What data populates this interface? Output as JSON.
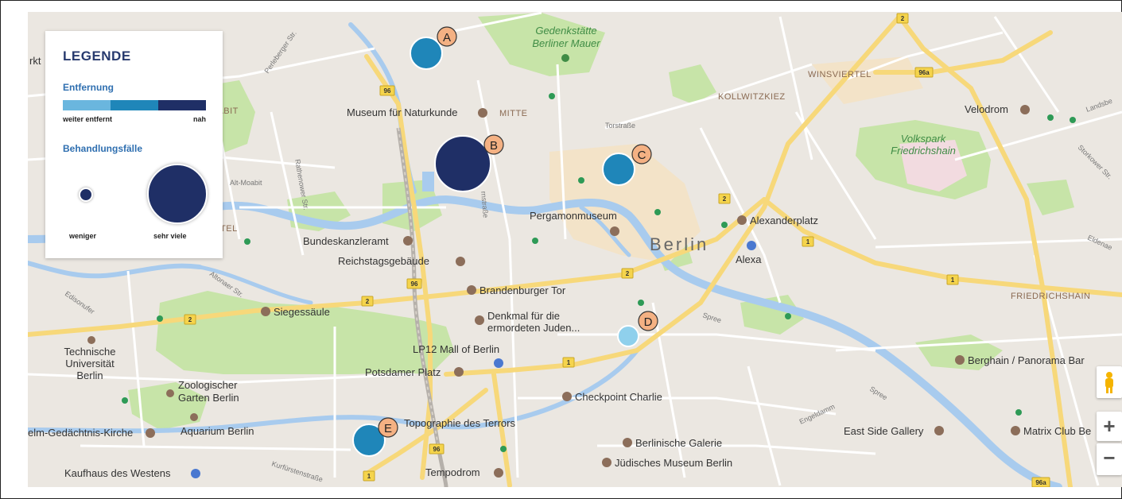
{
  "legend": {
    "title": "LEGENDE",
    "distance_heading": "Entfernung",
    "distance_far": "weiter entfernt",
    "distance_near": "nah",
    "distance_colors": [
      "#6ab6de",
      "#1f86b9",
      "#1f2f66"
    ],
    "cases_heading": "Behandlungsfälle",
    "cases_few": "weniger",
    "cases_many": "sehr viele"
  },
  "markers": [
    {
      "label": "A",
      "distance_class": "medium",
      "cases_level": "small"
    },
    {
      "label": "B",
      "distance_class": "near",
      "cases_level": "very large"
    },
    {
      "label": "C",
      "distance_class": "medium",
      "cases_level": "small"
    },
    {
      "label": "D",
      "distance_class": "far",
      "cases_level": "small"
    },
    {
      "label": "E",
      "distance_class": "medium",
      "cases_level": "small"
    }
  ],
  "places": {
    "gedenkstaette": "Gedenkstätte",
    "berliner_mauer": "Berliner Mauer",
    "winsviertel": "WINSVIERTEL",
    "kollwitzkiez": "KOLLWITZKIEZ",
    "museum_naturkunde": "Museum für Naturkunde",
    "mitte": "MITTE",
    "velodrom": "Velodrom",
    "volkspark": "Volkspark",
    "friedrichshain_park": "Friedrichshain",
    "torstrasse": "Torstraße",
    "alt_moabit": "Alt-Moabit",
    "moabit": "DABIT",
    "pergamonmuseum": "Pergamonmuseum",
    "berlin": "Berlin",
    "alexanderplatz": "Alexanderplatz",
    "alexa": "Alexa",
    "bundeskanzleramt": "Bundeskanzleramt",
    "reichstagsgebaeude": "Reichstagsgebäude",
    "brandenburger_tor": "Brandenburger Tor",
    "siegessaeule": "Siegessäule",
    "denkmal_1": "Denkmal für die",
    "denkmal_2": "ermordeten Juden...",
    "friedrichshain_district": "FRIEDRICHSHAIN",
    "technische_1": "Technische",
    "technische_2": "Universität",
    "technische_3": "Berlin",
    "lp12": "LP12 Mall of Berlin",
    "potsdamer_platz": "Potsdamer Platz",
    "berghain": "Berghain / Panorama Bar",
    "zoologischer_1": "Zoologischer",
    "zoologischer_2": "Garten Berlin",
    "checkpoint_charlie": "Checkpoint Charlie",
    "gedaechtniskirche": "elm-Gedächtnis-Kirche",
    "aquarium": "Aquarium Berlin",
    "topographie": "Topographie des Terrors",
    "east_side_gallery": "East Side Gallery",
    "matrix_club": "Matrix Club Be",
    "berlinische_galerie": "Berlinische Galerie",
    "juedisches_museum": "Jüdisches Museum Berlin",
    "kaufhaus": "Kaufhaus des Westens",
    "tempodrom": "Tempodrom",
    "ertel": "ERTEL",
    "kt": "rkt",
    "spree": "Spree",
    "spree2": "Spree",
    "perleberger": "Perleberger Str.",
    "rathenower": "Rathenower Str.",
    "altonaer": "Altonaer Str.",
    "kurfuerstenstr": "Kurfürstenstraße",
    "landsberger": "Landsbe",
    "storkower": "Storkower Str.",
    "eldenaer": "Eldenae",
    "engeldamm": "Engeldamm",
    "friedrichstrasse": "rnstraße",
    "ostend_str": "Edisonufer"
  },
  "road_shields": {
    "r96_top": "96",
    "r96_mid": "96",
    "r96_low": "96",
    "r2_top": "2",
    "r2_a": "2",
    "r2_b": "2",
    "r2_c": "2",
    "r2_d": "2",
    "r96a_top": "96a",
    "r96a_bot": "96a",
    "r1_a": "1",
    "r1_b": "1",
    "r1_c": "1",
    "r1_d": "1"
  },
  "controls": {
    "zoom_in": "+",
    "zoom_out": "−",
    "pegman_icon": "pegman-icon"
  }
}
